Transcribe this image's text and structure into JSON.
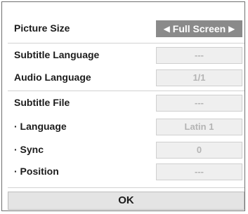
{
  "rows": [
    {
      "label": "Picture Size",
      "value": "Full Screen"
    },
    {
      "label": "Subtitle Language",
      "value": "---"
    },
    {
      "label": "Audio Language",
      "value": "1/1"
    },
    {
      "label": "Subtitle File",
      "value": "---"
    },
    {
      "label": "· Language",
      "value": "Latin 1"
    },
    {
      "label": "· Sync",
      "value": "0"
    },
    {
      "label": "· Position",
      "value": "---"
    }
  ],
  "arrows": {
    "left": "◀",
    "right": "▶"
  },
  "ok_label": "OK",
  "colors": {
    "selected_bg": "#8a8a8a",
    "field_bg": "#efefef",
    "field_text": "#b4b4b4"
  }
}
